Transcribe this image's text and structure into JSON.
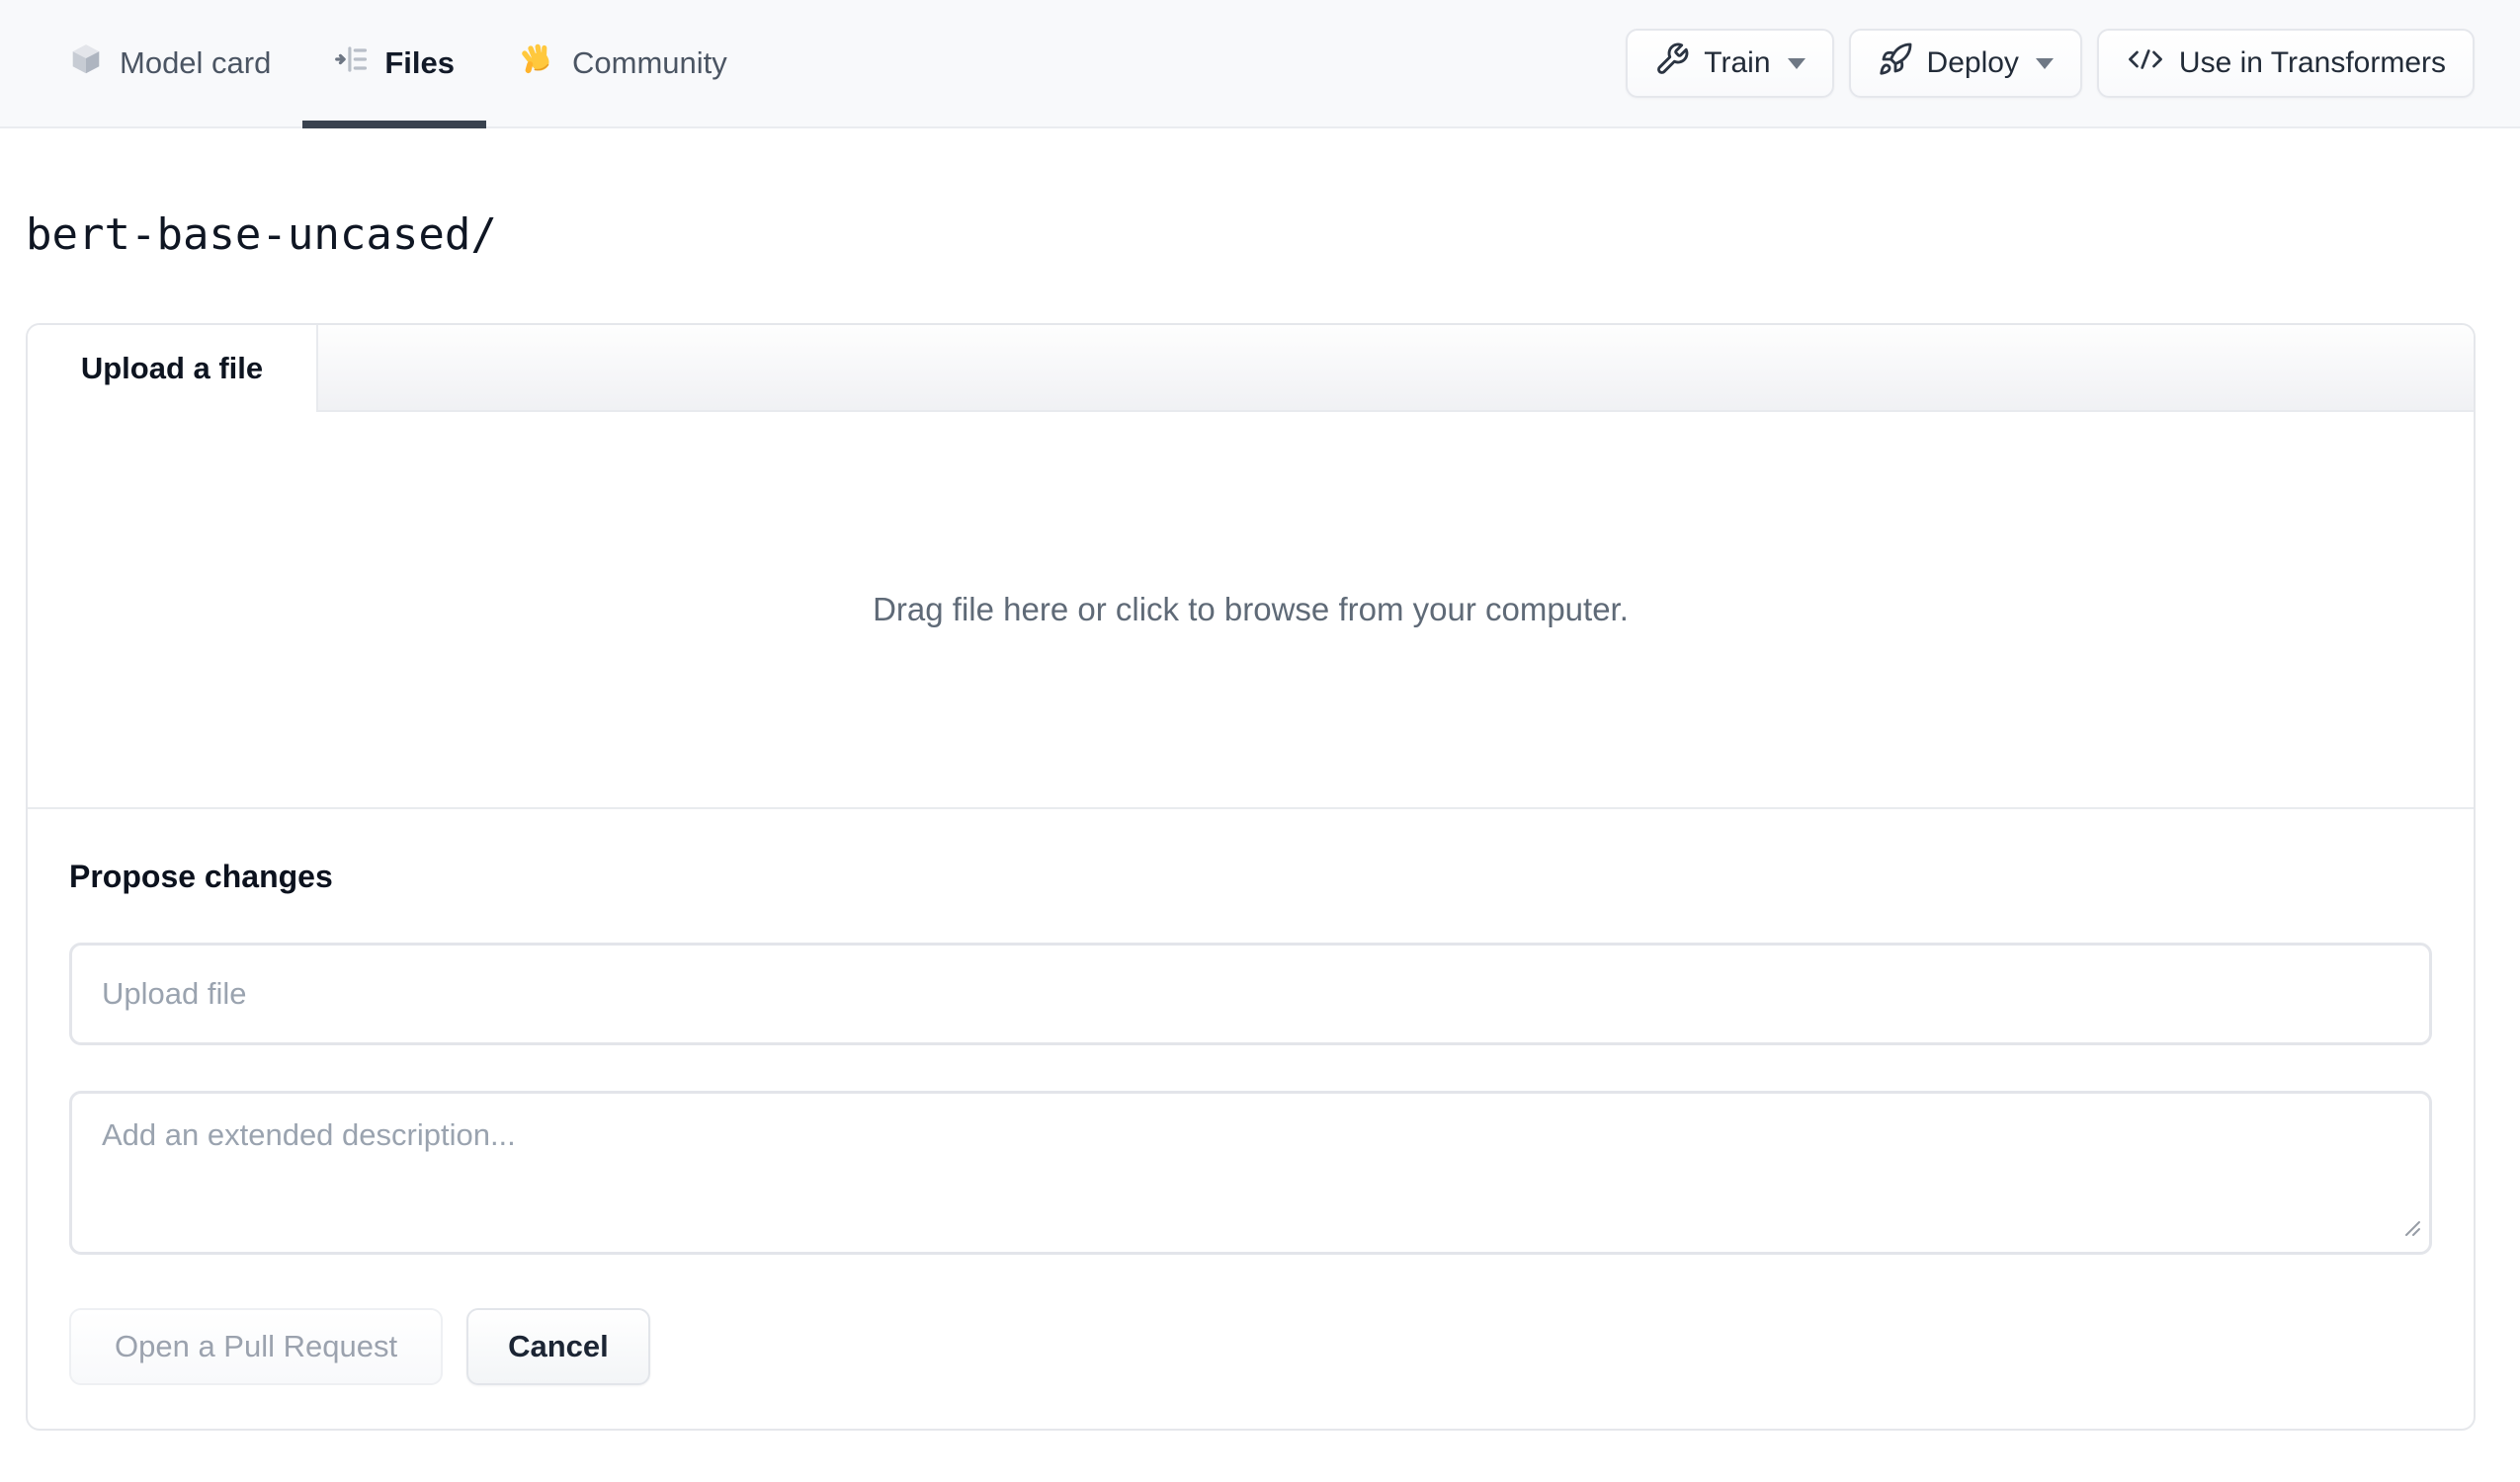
{
  "nav": {
    "tabs": [
      {
        "label": "Model card",
        "icon": "cube-icon",
        "active": false
      },
      {
        "label": "Files",
        "icon": "files-list-icon",
        "active": true
      },
      {
        "label": "Community",
        "icon": "waving-hand-icon",
        "active": false
      }
    ],
    "actions": [
      {
        "label": "Train",
        "icon": "wrench-icon",
        "has_dropdown": true
      },
      {
        "label": "Deploy",
        "icon": "rocket-icon",
        "has_dropdown": true
      },
      {
        "label": "Use in Transformers",
        "icon": "code-icon",
        "has_dropdown": false
      }
    ]
  },
  "breadcrumb": {
    "path": "bert-base-uncased/"
  },
  "upload_panel": {
    "tab_label": "Upload a file",
    "dropzone_text": "Drag file here or click to browse from your computer.",
    "propose_heading": "Propose changes",
    "filename_placeholder": "Upload file",
    "description_placeholder": "Add an extended description...",
    "primary_button": "Open a Pull Request",
    "cancel_button": "Cancel"
  },
  "colors": {
    "nav_background": "#f8f9fb",
    "active_tab_underline": "#39424f",
    "panel_border": "#e5e7eb",
    "muted_text": "#5f6a77",
    "placeholder_text": "#9aa3af",
    "emoji_hand": "#ffc83d"
  }
}
